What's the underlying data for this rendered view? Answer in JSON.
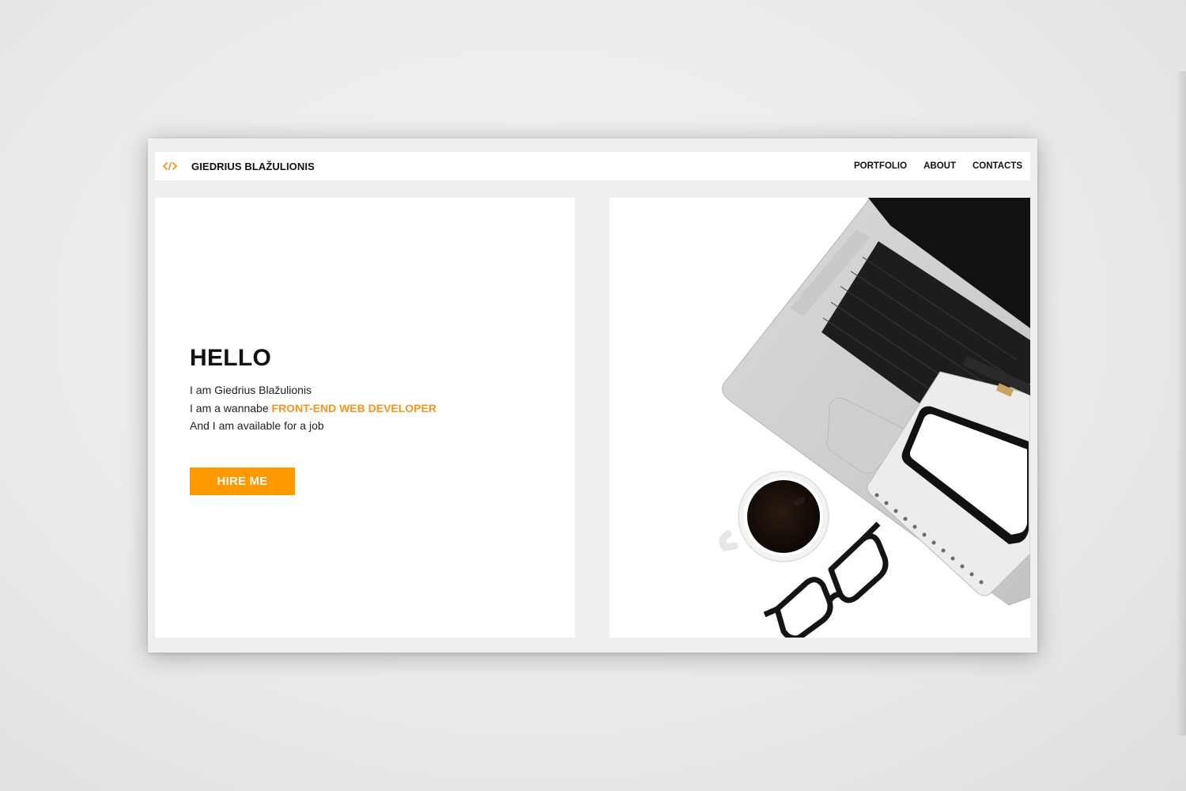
{
  "brand": {
    "logo_icon": "code-brackets-icon",
    "name": "GIEDRIUS BLAŽULIONIS"
  },
  "nav": {
    "items": [
      {
        "label": "PORTFOLIO"
      },
      {
        "label": "ABOUT"
      },
      {
        "label": "CONTACTS"
      }
    ]
  },
  "hero": {
    "heading": "HELLO",
    "line1": "I am Giedrius Blažulionis",
    "line2_prefix": "I am a wannabe ",
    "line2_highlight": "FRONT-END WEB DEVELOPER",
    "line3": "And I am available for a job",
    "cta_label": "HIRE ME",
    "image": "laptop-workspace-photo"
  },
  "colors": {
    "accent": "#ff9900",
    "highlight_text": "#f7941d",
    "text": "#111111",
    "page_background": "#efefef",
    "card_background": "#ffffff"
  }
}
